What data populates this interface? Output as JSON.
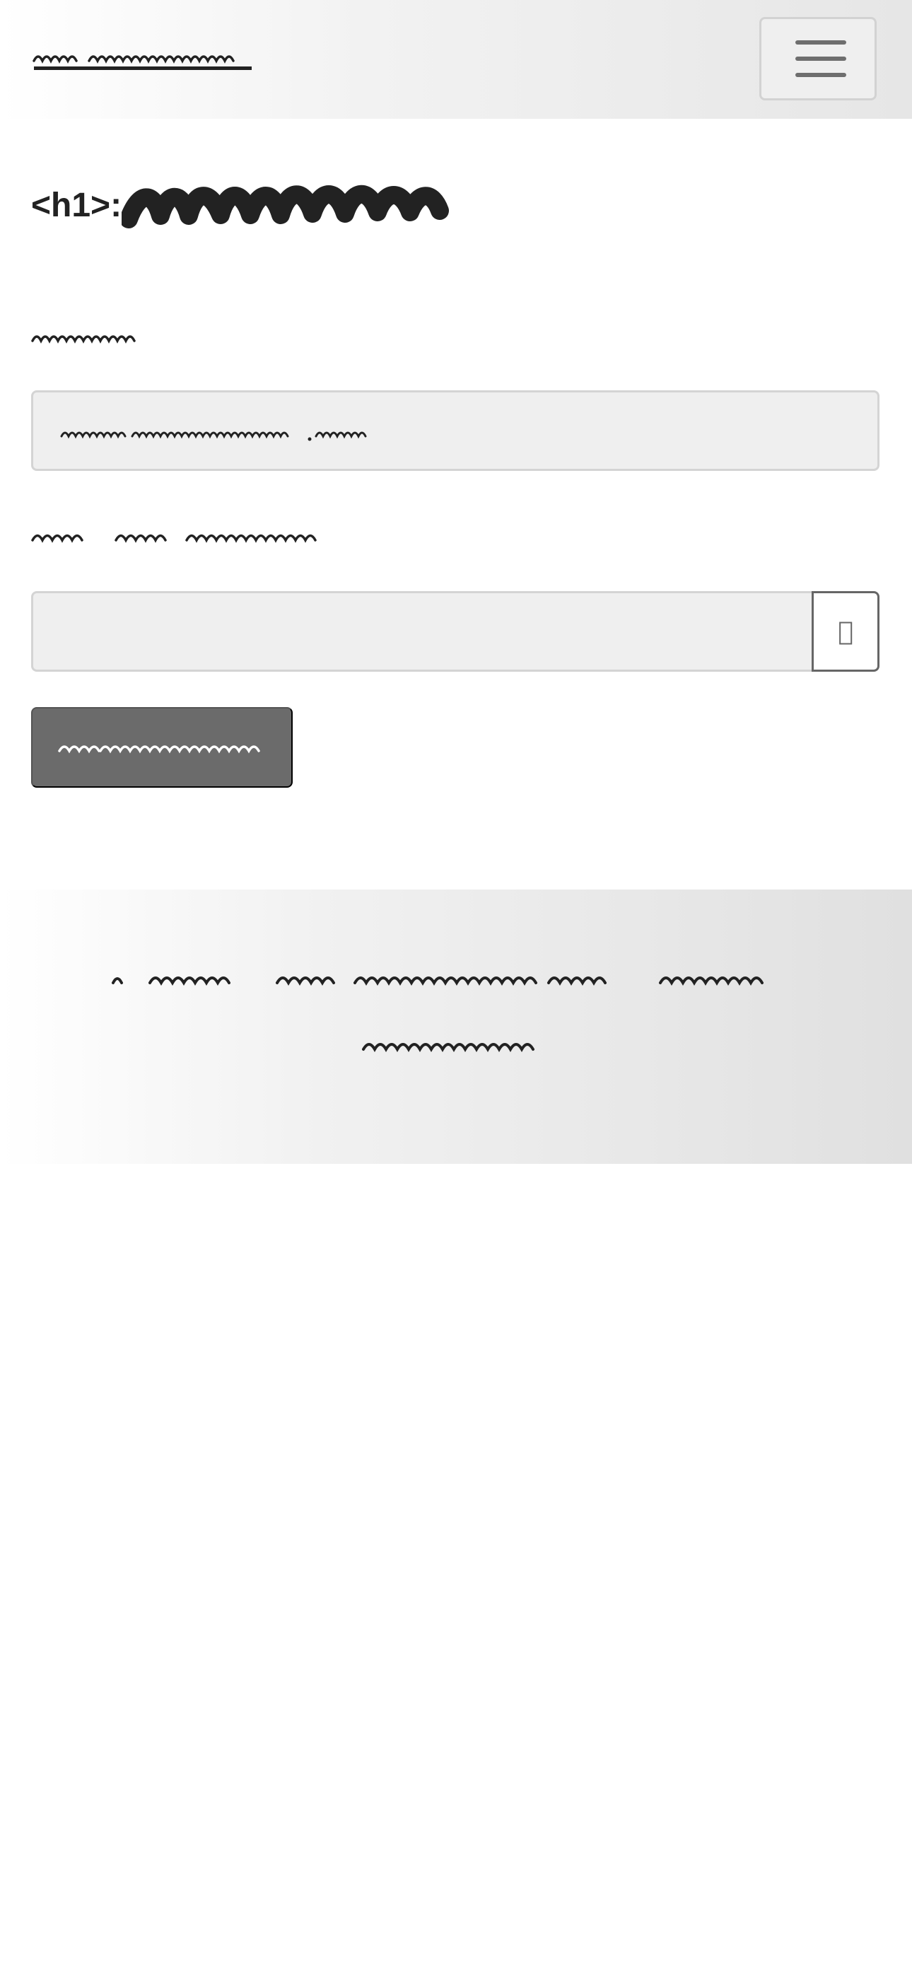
{
  "header": {
    "brand_icon": "scribble-link",
    "menu_icon": "hamburger-icon"
  },
  "main": {
    "heading_prefix": "<h1>:",
    "heading_icon": "redacted-scribble",
    "form": {
      "password_toggle_icon": "eye-icon"
    }
  },
  "colors": {
    "header_gradient_start": "#ffffff",
    "header_gradient_end": "#e6e6e6",
    "input_background": "#efefef",
    "input_border": "#d4d4d4",
    "button_background": "#6b6b6b",
    "text_dark": "#222222",
    "icon_gray": "#6e6e6e"
  }
}
